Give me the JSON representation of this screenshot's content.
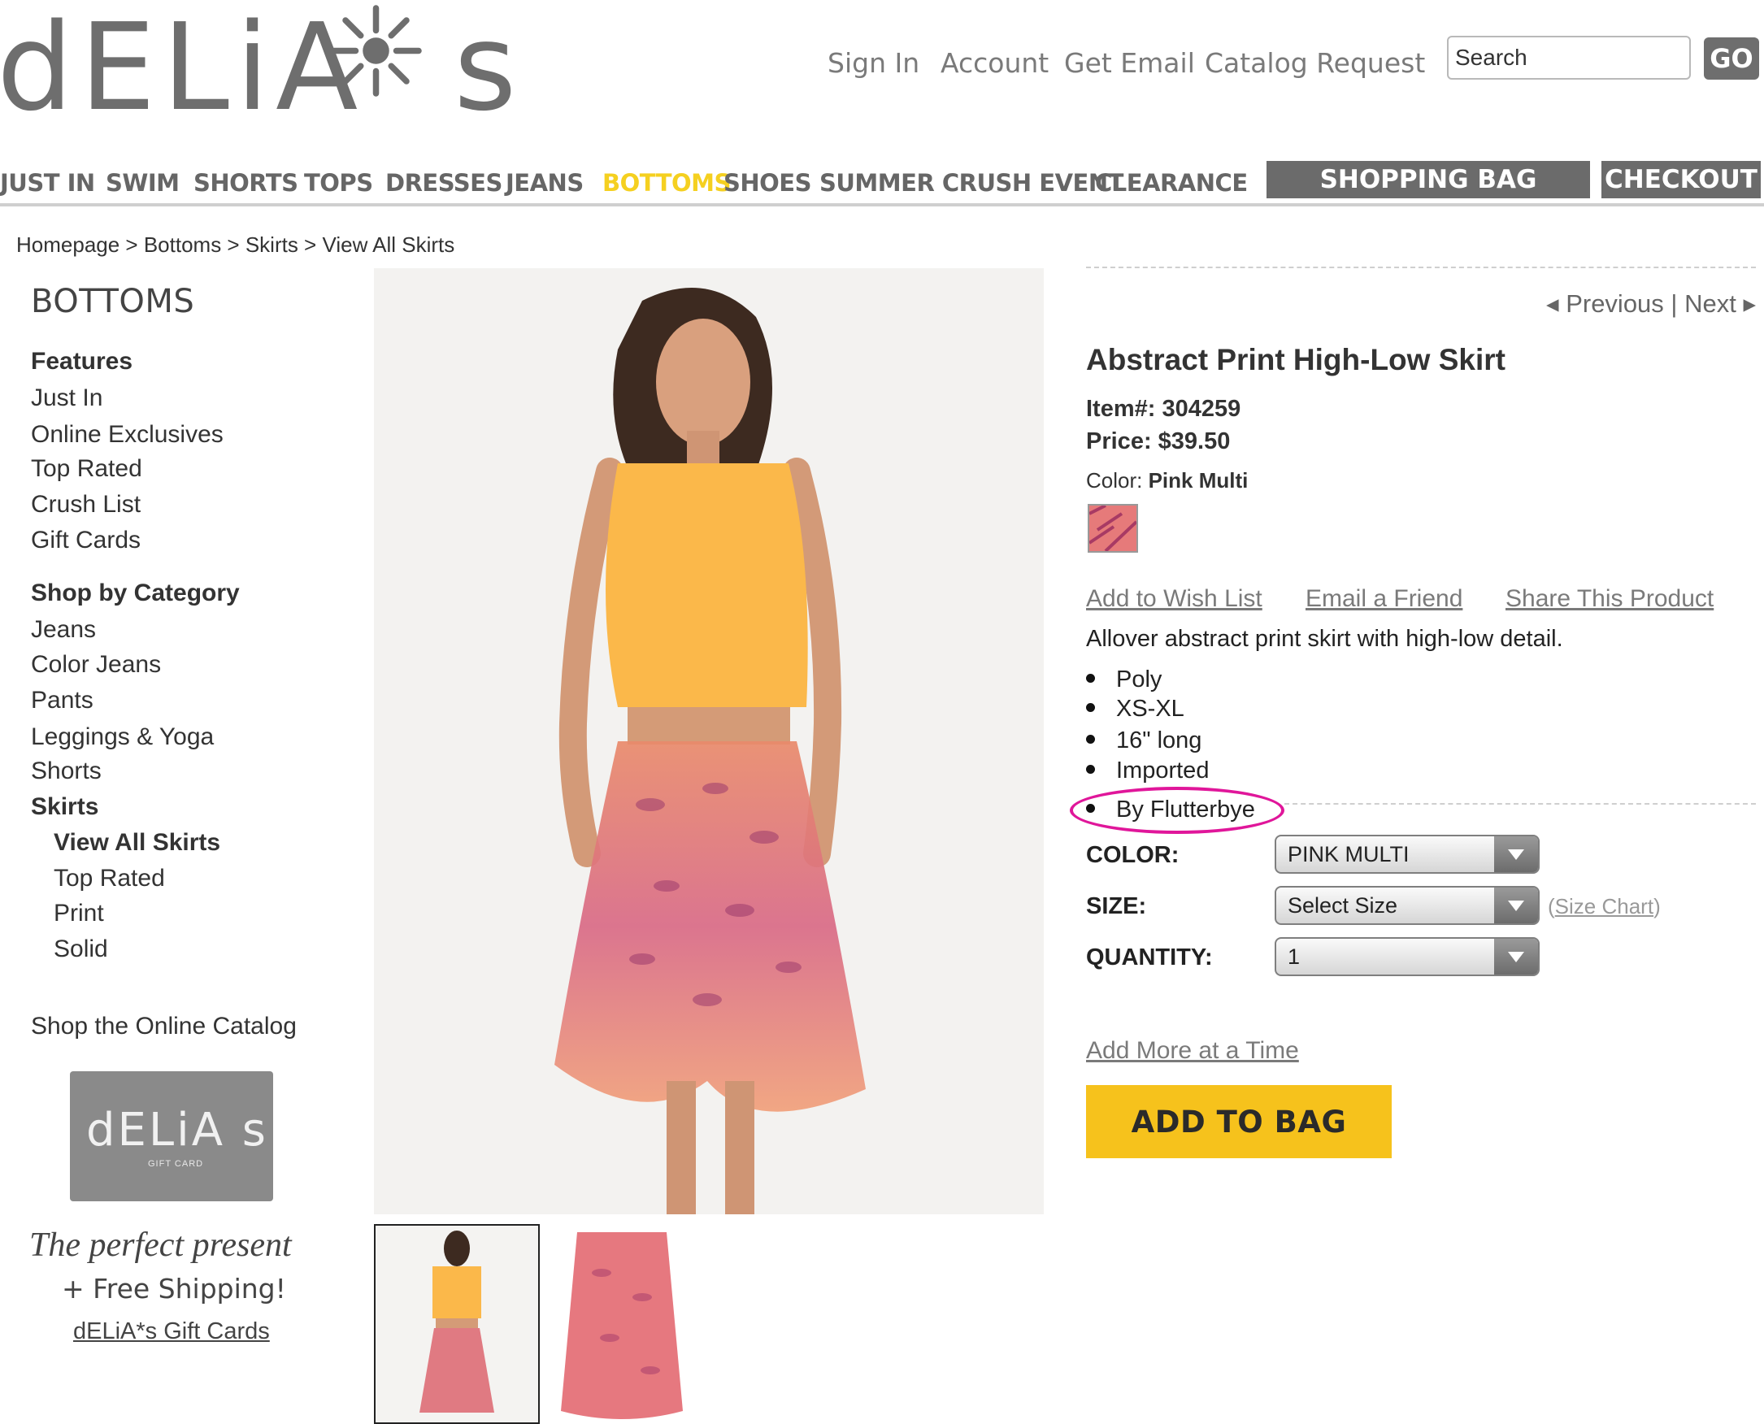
{
  "brand": {
    "logo_text": "dELiA",
    "logo_suffix": "s"
  },
  "header": {
    "links": [
      "Sign In",
      "Account",
      "Get Email",
      "Catalog Request"
    ],
    "search_placeholder": "Search",
    "go_label": "GO"
  },
  "nav": {
    "items": [
      "JUST IN",
      "SWIM",
      "SHORTS",
      "TOPS",
      "DRESSES",
      "JEANS",
      "BOTTOMS",
      "SHOES",
      "SUMMER CRUSH EVENT",
      "CLEARANCE"
    ],
    "active": "BOTTOMS",
    "shopping_bag": "SHOPPING BAG",
    "checkout": "CHECKOUT"
  },
  "breadcrumb": "Homepage > Bottoms > Skirts > View All Skirts",
  "sidebar": {
    "title": "BOTTOMS",
    "features_heading": "Features",
    "features": [
      "Just In",
      "Online Exclusives",
      "Top Rated",
      "Crush List",
      "Gift Cards"
    ],
    "category_heading": "Shop by Category",
    "categories": [
      "Jeans",
      "Color Jeans",
      "Pants",
      "Leggings & Yoga",
      "Shorts"
    ],
    "skirts": "Skirts",
    "skirt_subs": [
      "View All Skirts",
      "Top Rated",
      "Print",
      "Solid"
    ],
    "catalog_link": "Shop the Online Catalog",
    "gift_card_logo": "dELiA s",
    "gift_card_sub": "GIFT CARD",
    "perfect_present": "The perfect present",
    "free_shipping": "+ Free Shipping!",
    "gift_cards_link": "dELiA*s Gift Cards"
  },
  "product": {
    "prev_next": "Previous | Next",
    "title": "Abstract Print High-Low Skirt",
    "item_label": "Item#:",
    "item_number": "304259",
    "price_label": "Price:",
    "price": "$39.50",
    "color_label": "Color:",
    "color": "Pink Multi",
    "links": [
      "Add to Wish List",
      "Email a Friend",
      "Share This Product"
    ],
    "description": "Allover abstract print skirt with high-low detail.",
    "bullets": [
      "Poly",
      "XS-XL",
      "16\" long",
      "Imported",
      "By Flutterbye"
    ],
    "highlight_color": "#e0169a",
    "form": {
      "color_label": "COLOR:",
      "color_value": "PINK MULTI",
      "size_label": "SIZE:",
      "size_value": "Select Size",
      "size_chart": "Size Chart",
      "quantity_label": "QUANTITY:",
      "quantity_value": "1"
    },
    "add_more": "Add More at a Time",
    "add_to_bag": "ADD TO BAG",
    "button_color": "#f6c21c"
  }
}
